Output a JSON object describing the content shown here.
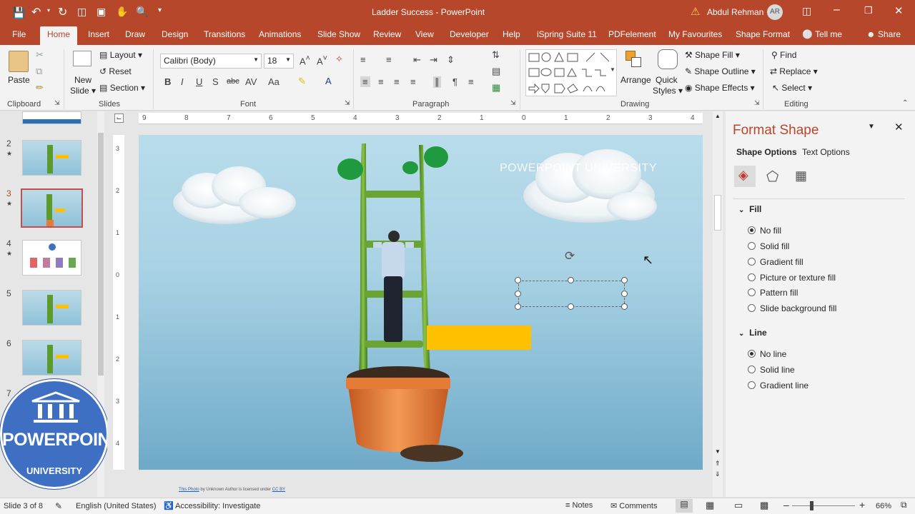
{
  "window": {
    "doc_title": "Ladder Success",
    "separator": " - ",
    "app_name": "PowerPoint",
    "user_name": "Abdul Rehman",
    "user_initials": "AR"
  },
  "tabs": [
    "File",
    "Home",
    "Insert",
    "Draw",
    "Design",
    "Transitions",
    "Animations",
    "Slide Show",
    "Review",
    "View",
    "Developer",
    "Help",
    "iSpring Suite 11",
    "PDFelement",
    "My Favourites",
    "Shape Format"
  ],
  "tell_me": "Tell me",
  "share": "Share",
  "ribbon": {
    "clipboard": {
      "paste": "Paste",
      "group": "Clipboard"
    },
    "slides": {
      "new_slide_1": "New",
      "new_slide_2": "Slide",
      "layout": "Layout",
      "reset": "Reset",
      "section": "Section",
      "group": "Slides"
    },
    "font": {
      "name": "Calibri (Body)",
      "size": "18",
      "group": "Font"
    },
    "paragraph": {
      "group": "Paragraph"
    },
    "drawing": {
      "arrange": "Arrange",
      "quick_styles_1": "Quick",
      "quick_styles_2": "Styles",
      "shape_fill": "Shape Fill",
      "shape_outline": "Shape Outline",
      "shape_effects": "Shape Effects",
      "group": "Drawing"
    },
    "editing": {
      "find": "Find",
      "replace": "Replace",
      "select": "Select",
      "group": "Editing"
    }
  },
  "ruler": {
    "h_ticks": [
      "9",
      "8",
      "7",
      "6",
      "5",
      "4",
      "3",
      "2",
      "1",
      "0",
      "1",
      "2",
      "3",
      "4"
    ],
    "v_ticks": [
      "3",
      "2",
      "1",
      "0",
      "1",
      "2",
      "3",
      "4"
    ]
  },
  "thumbnails": [
    {
      "num": "2",
      "star": "★"
    },
    {
      "num": "3",
      "star": "★"
    },
    {
      "num": "4",
      "star": "★"
    },
    {
      "num": "5",
      "star": ""
    },
    {
      "num": "6",
      "star": ""
    },
    {
      "num": "7",
      "star": ""
    }
  ],
  "slide": {
    "watermark": "POWERPOINT UNIVERSITY",
    "credit_link": "This Photo",
    "credit_mid": " by Unknown Author is licensed under ",
    "credit_license": "CC BY"
  },
  "logo": {
    "line1": "POWERPOINT",
    "line2": "UNIVERSITY"
  },
  "format_pane": {
    "title": "Format Shape",
    "tab_shape": "Shape Options",
    "tab_text": "Text Options",
    "fill_header": "Fill",
    "fill_options": [
      "No fill",
      "Solid fill",
      "Gradient fill",
      "Picture or texture fill",
      "Pattern fill",
      "Slide background fill"
    ],
    "fill_selected": "No fill",
    "line_header": "Line",
    "line_options": [
      "No line",
      "Solid line",
      "Gradient line"
    ],
    "line_selected": "No line"
  },
  "status": {
    "slide_info": "Slide 3 of 8",
    "language": "English (United States)",
    "accessibility": "Accessibility: Investigate",
    "notes": "Notes",
    "comments": "Comments",
    "zoom": "66%"
  },
  "colors": {
    "accent": "#b7472a",
    "sky_top": "#b8dcea",
    "sky_bottom": "#6fa9c8",
    "yellow_box": "#ffc000",
    "ladder_green": "#6aa533",
    "pot_orange": "#e47b36",
    "logo_blue": "#3e6fc2"
  }
}
